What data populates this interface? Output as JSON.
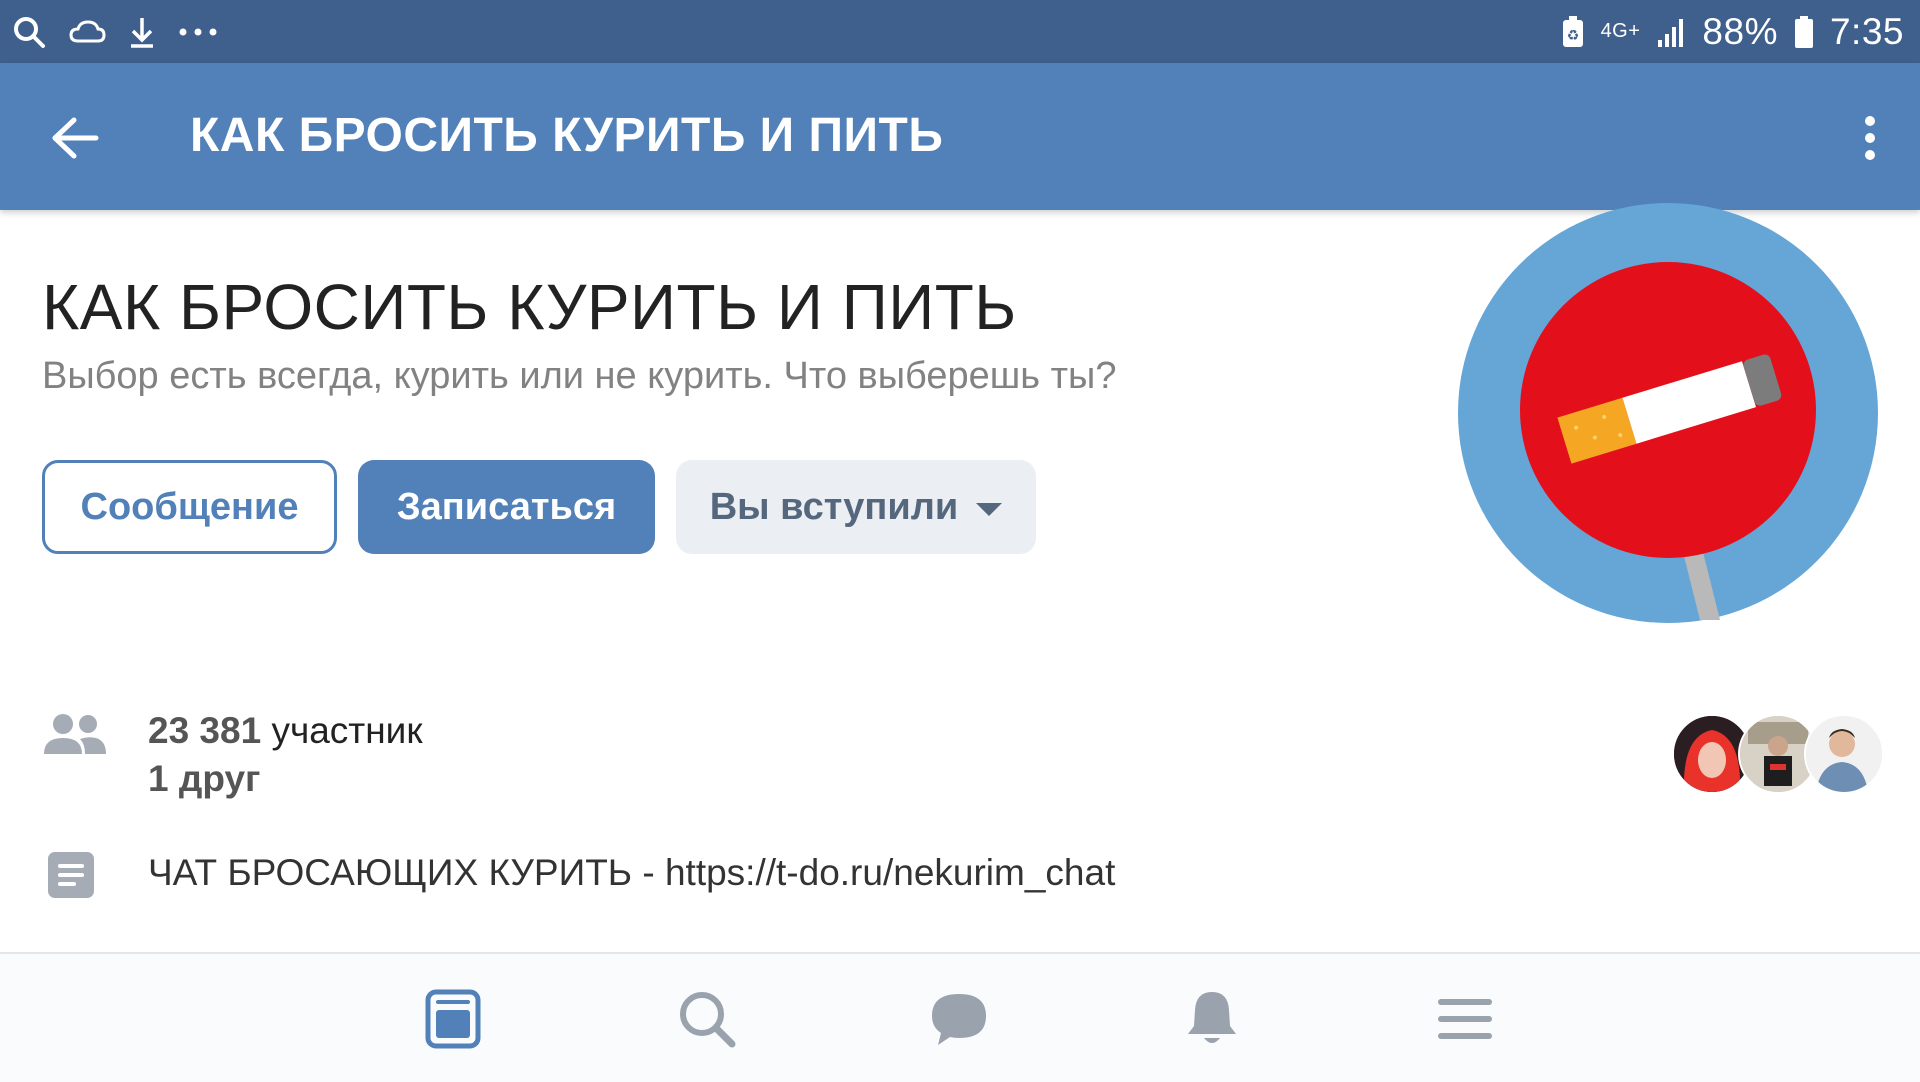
{
  "status_bar": {
    "network": "4G+",
    "battery": "88%",
    "time": "7:35",
    "icons": [
      "search-icon",
      "weather-icon",
      "download-icon",
      "more-dots-icon",
      "battery-saver-icon",
      "signal-icon",
      "battery-icon"
    ]
  },
  "app_bar": {
    "title": "КАК БРОСИТЬ КУРИТЬ И ПИТЬ",
    "back_icon": "arrow-left-icon",
    "menu_icon": "more-vertical-icon"
  },
  "group": {
    "name": "КАК БРОСИТЬ КУРИТЬ И ПИТЬ",
    "status": "Выбор есть всегда, курить или не курить. Что выберешь ты?",
    "avatar_icon": "no-smoking-sign"
  },
  "buttons": {
    "message": "Сообщение",
    "subscribe": "Записаться",
    "joined": "Вы вступили"
  },
  "members": {
    "count": "23 381",
    "label": " участник",
    "friends": "1 друг"
  },
  "description": {
    "text": "ЧАТ БРОСАЮЩИХ КУРИТЬ - https://t-do.ru/nekurim_chat"
  },
  "bottom_nav": [
    "news-icon",
    "search-icon",
    "messages-icon",
    "notifications-icon",
    "menu-icon"
  ],
  "colors": {
    "status_bar": "#3f5f8c",
    "app_bar": "#5181b8",
    "accent": "#5181b8",
    "secondary_button": "#ebeef2"
  }
}
